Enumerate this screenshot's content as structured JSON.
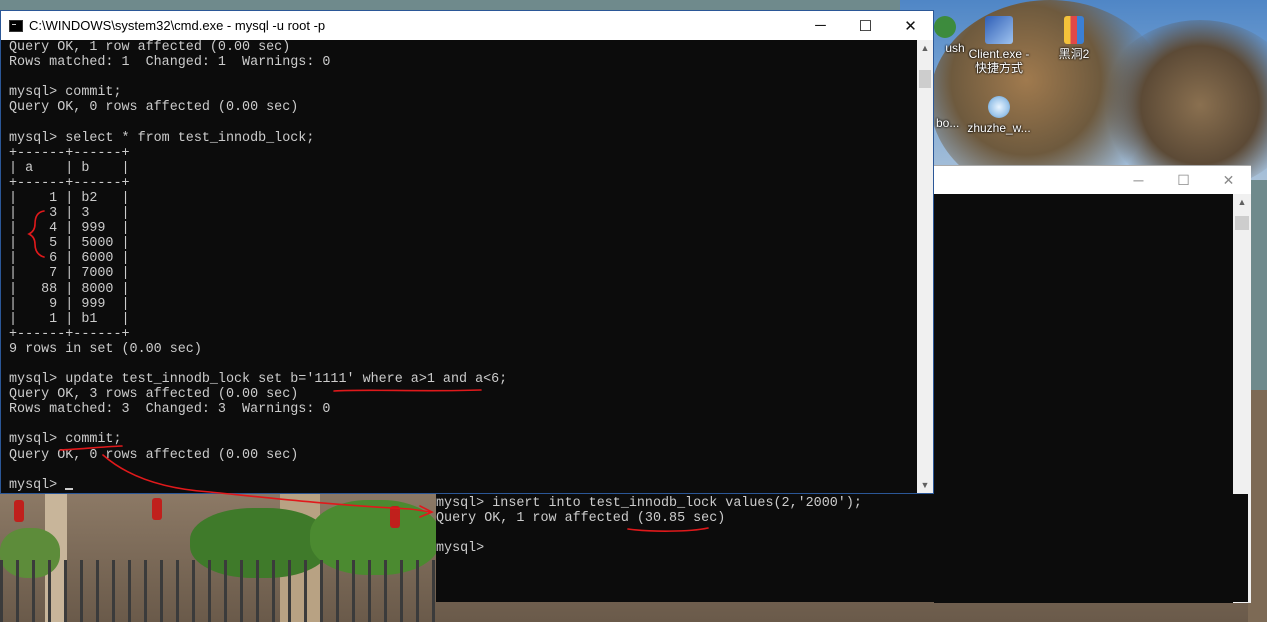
{
  "desktop": {
    "icons": [
      {
        "label": "ush",
        "icon": "app-icon"
      },
      {
        "label": "Client.exe - 快捷方式",
        "line1": "Client.exe -",
        "line2": "快捷方式",
        "icon": "shortcut-icon"
      },
      {
        "label": "黑洞2",
        "icon": "zip-folder-icon"
      },
      {
        "label": "bo...",
        "icon": "app-icon"
      },
      {
        "label": "zhuzhe_w...",
        "icon": "app-icon"
      }
    ]
  },
  "main_window": {
    "title": "C:\\WINDOWS\\system32\\cmd.exe - mysql  -u root -p",
    "controls": {
      "minimize": "─",
      "maximize": "☐",
      "close": "✕"
    },
    "lines": [
      "Query OK, 1 row affected (0.00 sec)",
      "Rows matched: 1  Changed: 1  Warnings: 0",
      "",
      "mysql> commit;",
      "Query OK, 0 rows affected (0.00 sec)",
      "",
      "mysql> select * from test_innodb_lock;",
      "+------+------+",
      "| a    | b    |",
      "+------+------+",
      "|    1 | b2   |",
      "|    3 | 3    |",
      "|    4 | 999  |",
      "|    5 | 5000 |",
      "|    6 | 6000 |",
      "|    7 | 7000 |",
      "|   88 | 8000 |",
      "|    9 | 999  |",
      "|    1 | b1   |",
      "+------+------+",
      "9 rows in set (0.00 sec)",
      "",
      "mysql> update test_innodb_lock set b='1111' where a>1 and a<6;",
      "Query OK, 3 rows affected (0.00 sec)",
      "Rows matched: 3  Changed: 3  Warnings: 0",
      "",
      "mysql> commit;",
      "Query OK, 0 rows affected (0.00 sec)",
      "",
      "mysql> "
    ]
  },
  "second_window": {
    "controls": {
      "minimize": "─",
      "maximize": "☐",
      "close": "✕"
    }
  },
  "front_console": {
    "lines": [
      "mysql> insert into test_innodb_lock values(2,'2000');",
      "Query OK, 1 row affected (30.85 sec)",
      "",
      "mysql>"
    ]
  },
  "annotation_color": "#e0191b"
}
